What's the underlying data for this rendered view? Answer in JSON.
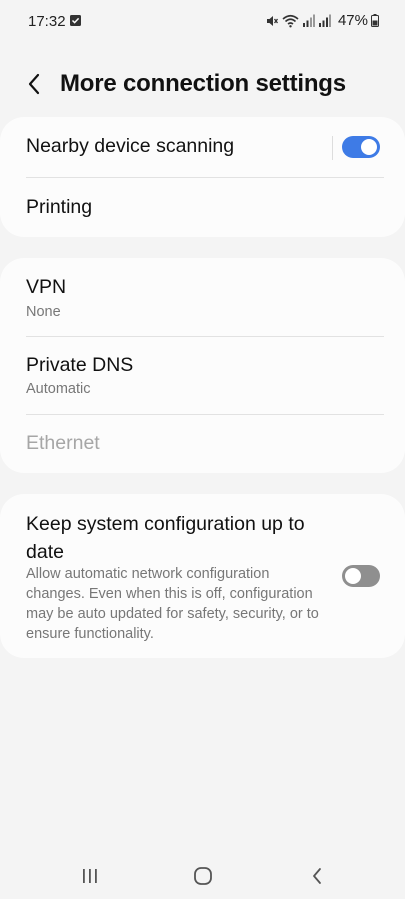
{
  "status_bar": {
    "time": "17:32",
    "battery": "47%",
    "icons": [
      "check-icon",
      "mute-icon",
      "wifi-icon",
      "signal-icon",
      "signal-icon",
      "battery-icon"
    ]
  },
  "header": {
    "title": "More connection settings",
    "back_icon": "chevron-left-icon"
  },
  "group1": {
    "nearby_scanning": {
      "label": "Nearby device scanning",
      "enabled": true
    },
    "printing": {
      "label": "Printing"
    }
  },
  "group2": {
    "vpn": {
      "label": "VPN",
      "value": "None"
    },
    "private_dns": {
      "label": "Private DNS",
      "value": "Automatic"
    },
    "ethernet": {
      "label": "Ethernet",
      "disabled": true
    }
  },
  "group3": {
    "keep_updated": {
      "label": "Keep system configuration up to date",
      "description": "Allow automatic network configuration changes. Even when this is off, configuration may be auto updated for safety, security, or to ensure functionality.",
      "enabled": false
    }
  },
  "nav": {
    "recents_icon": "recents-icon",
    "home_icon": "home-icon",
    "back_icon": "back-icon"
  },
  "colors": {
    "accent": "#3e7be6",
    "background": "#f4f4f4",
    "card": "#fcfcfc",
    "toggle_off": "#8f8f8f"
  }
}
